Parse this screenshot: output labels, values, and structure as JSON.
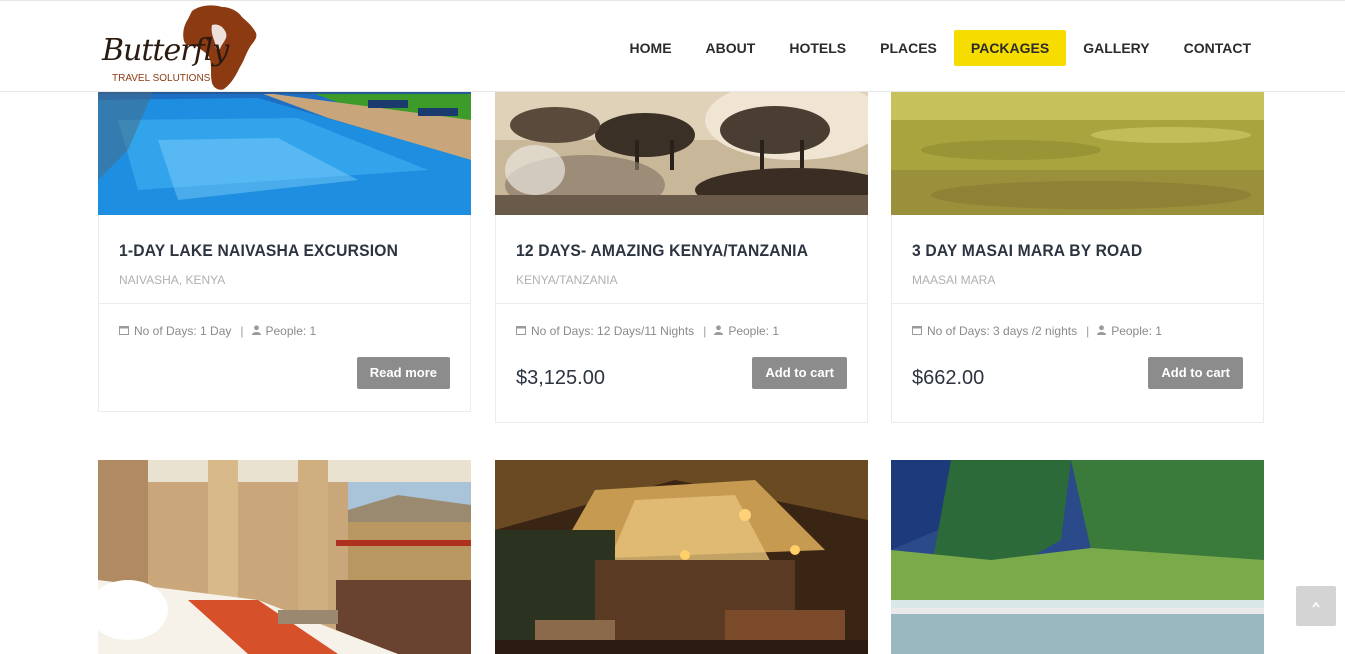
{
  "logo": {
    "word": "Butterfly",
    "subtitle": "TRAVEL SOLUTIONS",
    "brand_color": "#8b3a12"
  },
  "nav": {
    "items": [
      "HOME",
      "ABOUT",
      "HOTELS",
      "PLACES",
      "PACKAGES",
      "GALLERY",
      "CONTACT"
    ],
    "active": "PACKAGES",
    "accent_color": "#f7dc00"
  },
  "packages": [
    {
      "title": "1-DAY LAKE NAIVASHA EXCURSION",
      "location": "NAIVASHA, KENYA",
      "days": "No of Days: 1 Day",
      "people": "People: 1",
      "price": "",
      "button": "Read more",
      "image": "hotel-pool"
    },
    {
      "title": "12 DAYS- AMAZING KENYA/TANZANIA",
      "location": "KENYA/TANZANIA",
      "days": "No of Days: 12 Days/11 Nights",
      "people": "People: 1",
      "price": "$3,125.00",
      "button": "Add to cart",
      "image": "wildebeest-migration"
    },
    {
      "title": "3 DAY MASAI MARA BY ROAD",
      "location": "MAASAI MARA",
      "days": "No of Days: 3 days /2 nights",
      "people": "People: 1",
      "price": "$662.00",
      "button": "Add to cart",
      "image": "savanna-grassland"
    }
  ],
  "second_row_images": [
    "luxury-tent-bedroom",
    "safari-camp-tent-night",
    "lake-flamingos-cliffs"
  ],
  "scroll_top": {
    "icon": "chevron-up-icon"
  },
  "colors": {
    "button_bg": "#8c8c8c",
    "title_text": "#2c3440",
    "location_text": "#b0b0b0"
  }
}
